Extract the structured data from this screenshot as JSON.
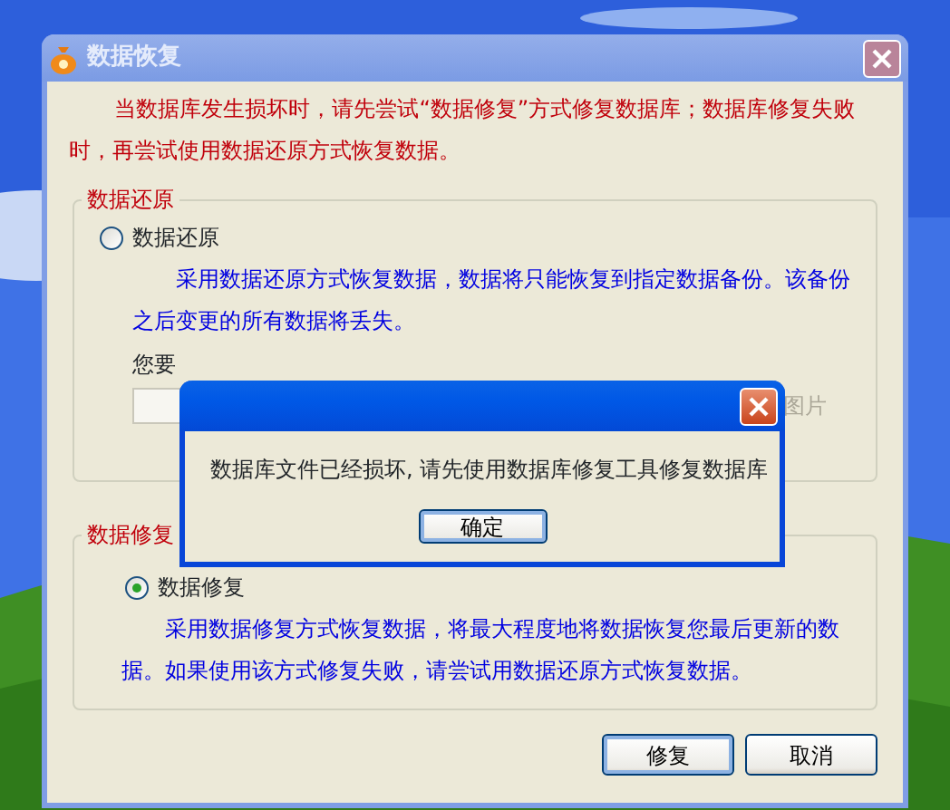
{
  "window": {
    "title": "数据恢复"
  },
  "notice": "当数据库发生损坏时，请先尝试“数据修复”方式修复数据库；数据库修复失败时，再尝试使用数据还原方式恢复数据。",
  "restore_group": {
    "title": "数据还原",
    "option": {
      "label": "数据还原",
      "selected": false
    },
    "description": "采用数据还原方式恢复数据，数据将只能恢复到指定数据备份。该备份之后变更的所有数据将丢失。",
    "question": "您要",
    "image_label": "图片"
  },
  "repair_group": {
    "title": "数据修复",
    "option": {
      "label": "数据修复",
      "selected": true
    },
    "description": "采用数据修复方式恢复数据，将最大程度地将数据恢复您最后更新的数据。如果使用该方式修复失败，请尝试用数据还原方式恢复数据。"
  },
  "buttons": [
    {
      "label": "修复",
      "default": true
    },
    {
      "label": "取消",
      "default": false
    }
  ],
  "message_box": {
    "message": "数据库文件已经损坏, 请先使用数据库修复工具修复数据库",
    "button": "确定"
  }
}
